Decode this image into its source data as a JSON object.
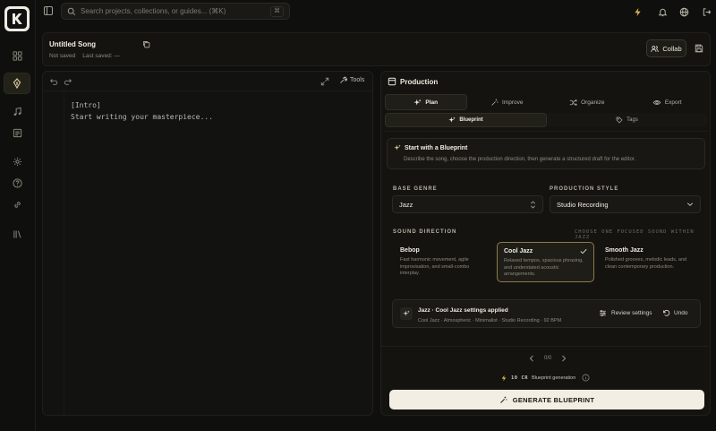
{
  "search": {
    "placeholder": "Search projects, collections, or guides... (⌘K)",
    "shortcut": "⌘"
  },
  "song": {
    "title": "Untitled Song",
    "status": "Not saved",
    "last_saved": "Last saved: —",
    "collab_label": "Collab"
  },
  "editor": {
    "tools_label": "Tools",
    "lines": [
      "[Intro]",
      "Start writing your masterpiece..."
    ]
  },
  "production": {
    "title": "Production",
    "tabs": [
      {
        "label": "Plan",
        "icon": "sparkles-icon",
        "active": true
      },
      {
        "label": "Improve",
        "icon": "wand-icon",
        "active": false
      },
      {
        "label": "Organize",
        "icon": "shuffle-icon",
        "active": false
      },
      {
        "label": "Export",
        "icon": "eye-icon",
        "active": false
      }
    ],
    "subtabs": [
      {
        "label": "Blueprint",
        "icon": "sparkles-icon",
        "active": true
      },
      {
        "label": "Tags",
        "icon": "tag-icon",
        "active": false
      }
    ],
    "blueprint": {
      "title": "Start with a Blueprint",
      "description": "Describe the song, choose the production direction, then generate a structured draft for the editor."
    },
    "base_genre": {
      "label": "BASE GENRE",
      "value": "Jazz"
    },
    "production_style": {
      "label": "PRODUCTION STYLE",
      "value": "Studio Recording"
    },
    "sound_direction": {
      "label": "SOUND DIRECTION",
      "hint": "CHOOSE ONE FOCUSED SOUND WITHIN JAZZ",
      "options": [
        {
          "name": "Bebop",
          "description": "Fast harmonic movement, agile improvisation, and small-combo interplay.",
          "selected": false
        },
        {
          "name": "Cool Jazz",
          "description": "Relaxed tempos, spacious phrasing, and understated acoustic arrangements.",
          "selected": true
        },
        {
          "name": "Smooth Jazz",
          "description": "Polished grooves, melodic leads, and clean contemporary production.",
          "selected": false
        }
      ]
    },
    "applied": {
      "title": "Jazz · Cool Jazz settings applied",
      "tags": "Cool Jazz · Atmospheric · Minimalist · Studio Recording · 92 BPM",
      "review_label": "Review settings",
      "undo_label": "Undo"
    },
    "pager": {
      "text": "0/0"
    },
    "credits": {
      "amount": "10 CR",
      "label": "Blueprint generation"
    },
    "generate_label": "GENERATE BLUEPRINT"
  },
  "colors": {
    "accent": "#d6c69a",
    "selected_border": "#8b7a4c",
    "primary_button": "#f2eee4",
    "background": "#0f0f0d"
  }
}
